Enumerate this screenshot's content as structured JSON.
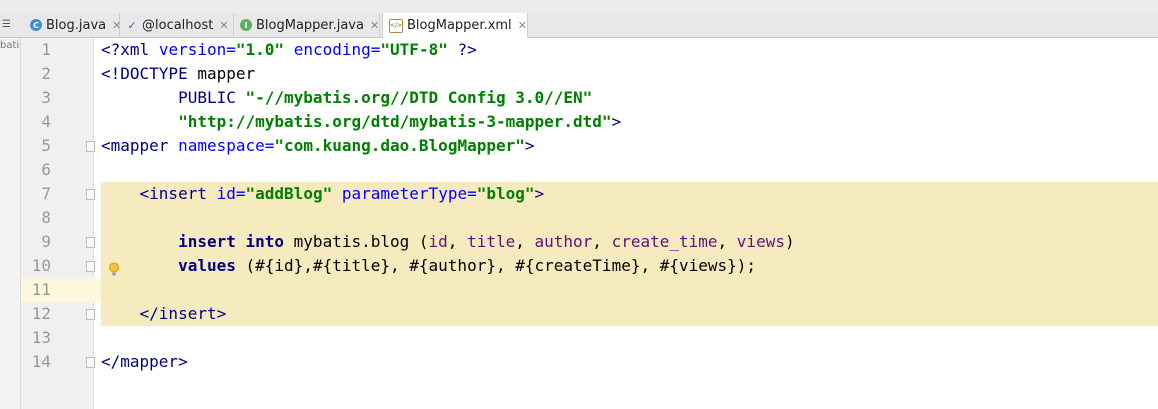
{
  "tabs": [
    {
      "label": "Blog.java",
      "icon": "class-c-icon",
      "active": false
    },
    {
      "label": "@localhost",
      "icon": "database-console-icon",
      "active": false
    },
    {
      "label": "BlogMapper.java",
      "icon": "interface-i-icon",
      "active": false
    },
    {
      "label": "BlogMapper.xml",
      "icon": "xml-file-icon",
      "active": true
    }
  ],
  "left_strip_label": "batis",
  "colors": {
    "tag": "#000080",
    "attr_name": "#0000ff",
    "attr_value": "#008000",
    "highlight": "#f6ebbf",
    "line_number": "#999999"
  },
  "lines": [
    {
      "n": "1",
      "text": "<?xml version=\"1.0\" encoding=\"UTF-8\" ?>"
    },
    {
      "n": "2",
      "text": "<!DOCTYPE mapper"
    },
    {
      "n": "3",
      "text": "        PUBLIC \"-//mybatis.org//DTD Config 3.0//EN\""
    },
    {
      "n": "4",
      "text": "        \"http://mybatis.org/dtd/mybatis-3-mapper.dtd\">"
    },
    {
      "n": "5",
      "text": "<mapper namespace=\"com.kuang.dao.BlogMapper\">"
    },
    {
      "n": "6",
      "text": ""
    },
    {
      "n": "7",
      "text": "    <insert id=\"addBlog\" parameterType=\"blog\">"
    },
    {
      "n": "8",
      "text": ""
    },
    {
      "n": "9",
      "text": "        insert into mybatis.blog (id, title, author, create_time, views)"
    },
    {
      "n": "10",
      "text": "        values (#{id},#{title}, #{author}, #{createTime}, #{views});"
    },
    {
      "n": "11",
      "text": ""
    },
    {
      "n": "12",
      "text": "    </insert>"
    },
    {
      "n": "13",
      "text": ""
    },
    {
      "n": "14",
      "text": "</mapper>"
    }
  ]
}
